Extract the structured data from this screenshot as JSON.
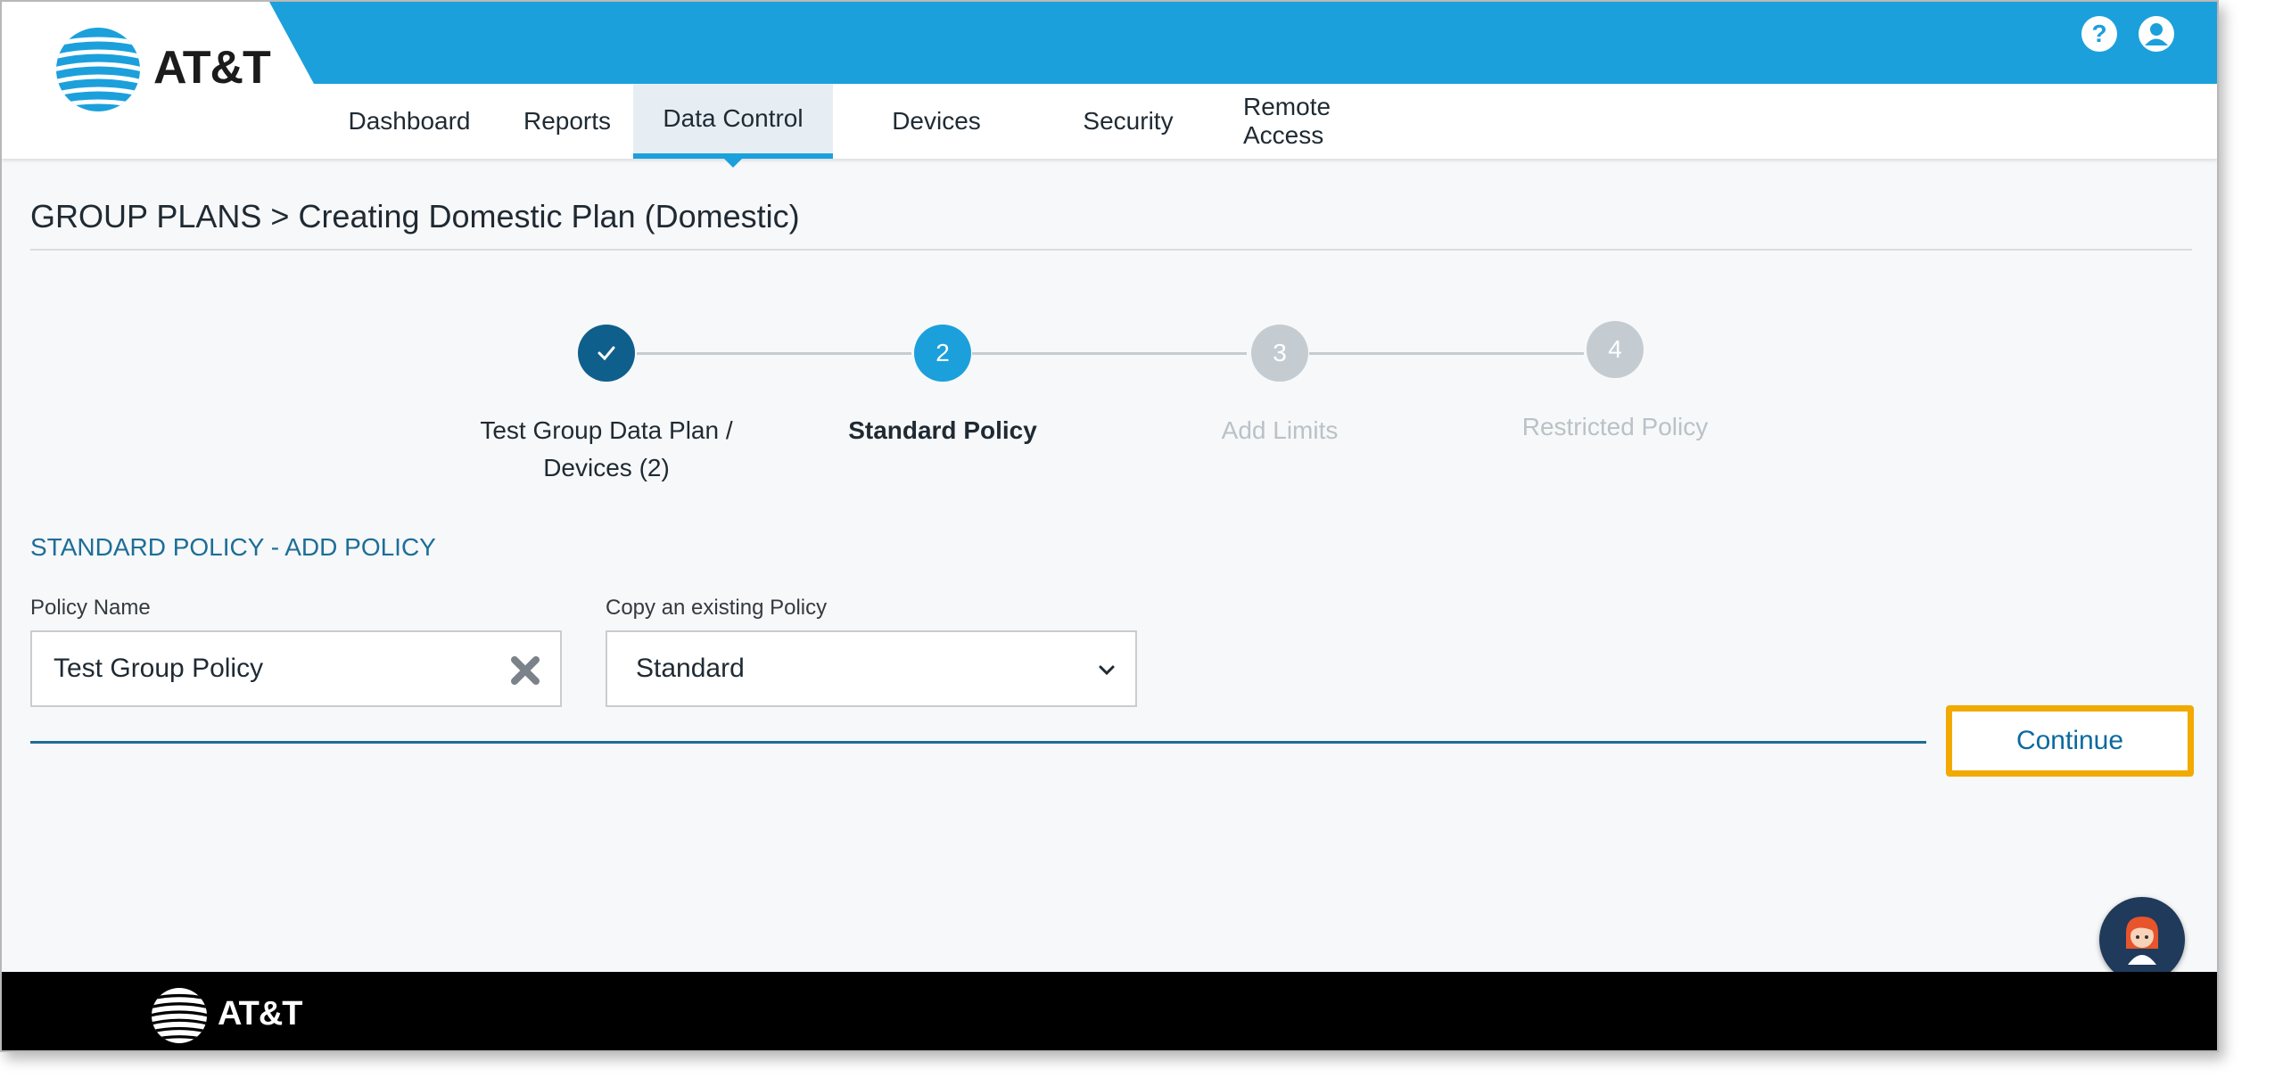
{
  "brand": {
    "name": "AT&T",
    "primary_color": "#1ba0dc",
    "accent_color": "#f2a900"
  },
  "header": {
    "icons": [
      "help-icon",
      "user-account-icon"
    ],
    "nav": [
      {
        "label": "Dashboard",
        "active": false
      },
      {
        "label": "Reports",
        "active": false
      },
      {
        "label": "Data Control",
        "active": true
      },
      {
        "label": "Devices",
        "active": false
      },
      {
        "label": "Security",
        "active": false
      },
      {
        "label": "Remote Access",
        "active": false
      }
    ]
  },
  "breadcrumb": "GROUP PLANS > Creating Domestic Plan (Domestic)",
  "stepper": {
    "steps": [
      {
        "number": "",
        "label": "Test Group Data Plan / Devices (2)",
        "state": "complete"
      },
      {
        "number": "2",
        "label": "Standard Policy",
        "state": "current"
      },
      {
        "number": "3",
        "label": "Add Limits",
        "state": "upcoming"
      },
      {
        "number": "4",
        "label": "Restricted Policy",
        "state": "upcoming"
      }
    ]
  },
  "section": {
    "title": "STANDARD POLICY - ADD POLICY",
    "policy_name": {
      "label": "Policy Name",
      "value": "Test Group Policy"
    },
    "copy_policy": {
      "label": "Copy an existing Policy",
      "selected": "Standard"
    }
  },
  "actions": {
    "continue_label": "Continue"
  },
  "footer": {
    "brand": "AT&T"
  },
  "scrollbar": {
    "up_arrow": "˄",
    "down_arrow": "˅"
  }
}
